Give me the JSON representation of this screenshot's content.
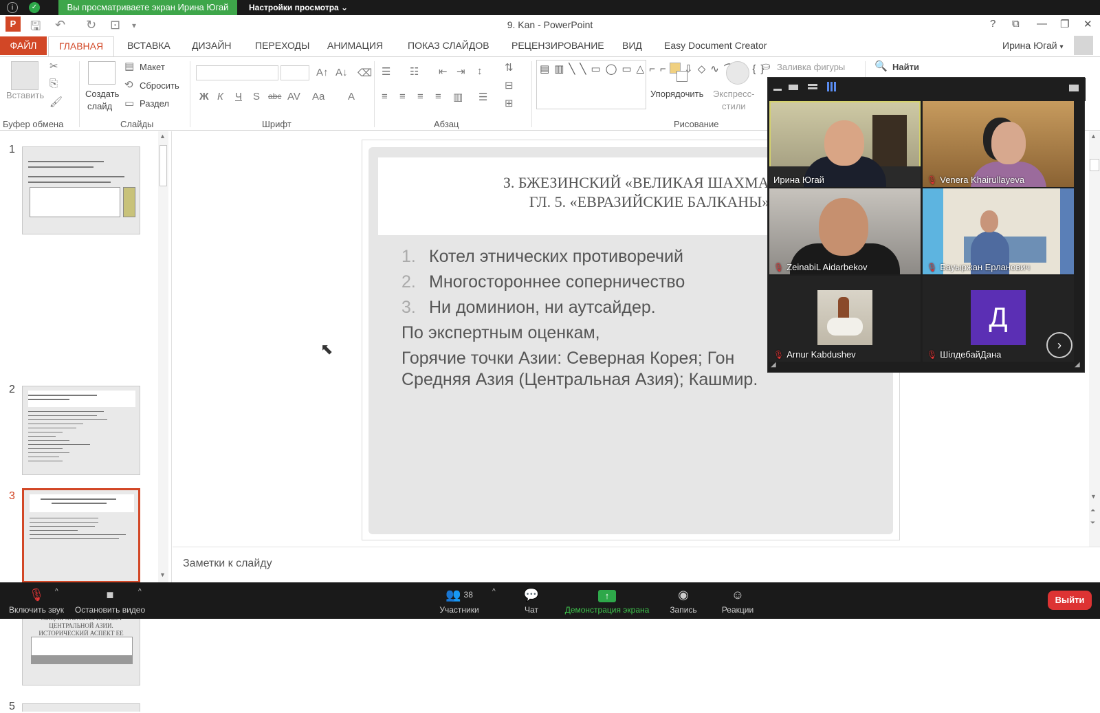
{
  "zoom_top": {
    "banner": "Вы просматриваете экран Ирина Югай",
    "view_options": "Настройки просмотра"
  },
  "app": {
    "title": "9. Kan - PowerPoint",
    "user": "Ирина Югай"
  },
  "ribbon_tabs": [
    "ФАЙЛ",
    "ГЛАВНАЯ",
    "ВСТАВКА",
    "ДИЗАЙН",
    "ПЕРЕХОДЫ",
    "АНИМАЦИЯ",
    "ПОКАЗ СЛАЙДОВ",
    "РЕЦЕНЗИРОВАНИЕ",
    "ВИД",
    "Easy Document Creator"
  ],
  "ribbon": {
    "paste": "Вставить",
    "new_slide_1": "Создать",
    "new_slide_2": "слайд",
    "layout": "Макет",
    "reset": "Сбросить",
    "section": "Раздел",
    "arrange": "Упорядочить",
    "quick_styles_1": "Экспресс-",
    "quick_styles_2": "стили",
    "shape_fill": "Заливка фигуры",
    "find": "Найти",
    "font_bold": "Ж",
    "font_italic": "К",
    "font_underline": "Ч",
    "font_strike": "S",
    "font_abc": "abc",
    "font_spacing": "AV",
    "font_case": "Aa",
    "font_color": "A",
    "groups": {
      "clipboard": "Буфер обмена",
      "slides": "Слайды",
      "font": "Шрифт",
      "paragraph": "Абзац",
      "drawing": "Рисование"
    }
  },
  "thumbnails": [
    {
      "num": "1"
    },
    {
      "num": "2"
    },
    {
      "num": "3",
      "selected": true
    },
    {
      "num": "4",
      "title": "ОБЩАЯ ХАРАКТЕРИСТИКА ЦЕНТРАЛЬНОЙ АЗИИ. ИСТОРИЧЕСКИЙ АСПЕКТ ЕЕ РАЗВИТИЯ."
    },
    {
      "num": "5"
    }
  ],
  "slide": {
    "title_line1": "З. БЖЕЗИНСКИЙ «ВЕЛИКАЯ ШАХМАТНАЯ Д",
    "title_line2": "ГЛ. 5. «ЕВРАЗИЙСКИЕ БАЛКАНЫ»",
    "items": [
      {
        "n": "1.",
        "text": "Котел этнических противоречий"
      },
      {
        "n": "2.",
        "text": "Многостороннее соперничество"
      },
      {
        "n": "3.",
        "text": "Ни доминион, ни аутсайдер."
      }
    ],
    "para1": "По экспертным оценкам,",
    "para2_line1": "Горячие точки Азии: Северная Корея; Гон",
    "para2_line2": "Средняя Азия (Центральная Азия); Кашмир."
  },
  "notes_placeholder": "Заметки к слайду",
  "participants": [
    {
      "name": "Ирина Югай",
      "muted": false,
      "active": true
    },
    {
      "name": "Venera Khairullayeva",
      "muted": true
    },
    {
      "name": "ZeinabiL Aidarbekov",
      "muted": true
    },
    {
      "name": "Бауыржан Ерланович",
      "muted": true
    },
    {
      "name": "Arnur Kabdushev",
      "muted": true
    },
    {
      "name": "ШілдебайДана",
      "muted": true,
      "initial": "Д"
    }
  ],
  "zoom_bottom": {
    "unmute": "Включить звук",
    "stop_video": "Остановить видео",
    "participants": "Участники",
    "participants_count": "38",
    "chat": "Чат",
    "share": "Демонстрация экрана",
    "record": "Запись",
    "reactions": "Реакции",
    "leave": "Выйти"
  },
  "colors": {
    "accent_office": "#d24726",
    "zoom_green": "#3ea64a",
    "leave_red": "#dd3333",
    "avatar_purple": "#5b2fb4"
  }
}
